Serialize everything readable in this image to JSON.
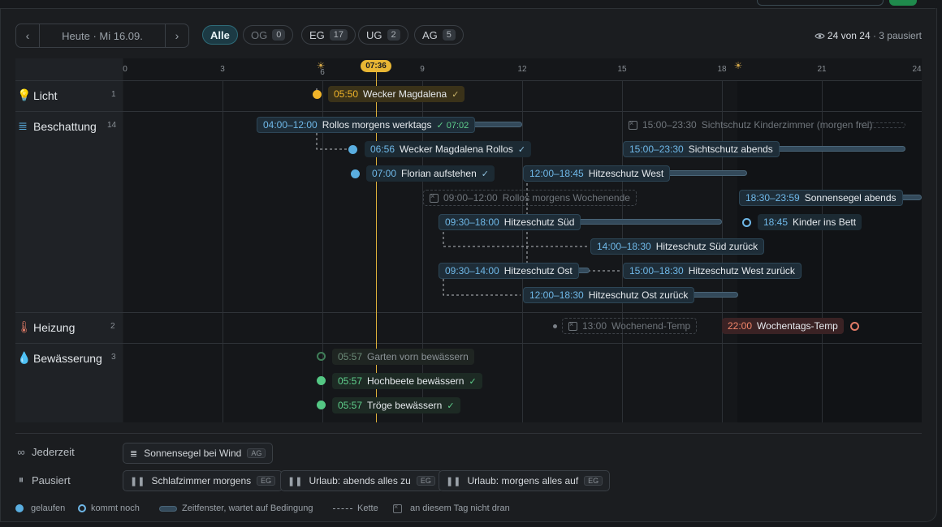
{
  "toolbar": {
    "prev": "‹",
    "next": "›",
    "date_label": "Heute · Mi 16.09.",
    "filters": [
      {
        "label": "Alle",
        "count": "",
        "active": true
      },
      {
        "label": "OG",
        "count": "0",
        "active": false
      },
      {
        "label": "EG",
        "count": "17",
        "active": false
      },
      {
        "label": "UG",
        "count": "2",
        "active": false
      },
      {
        "label": "AG",
        "count": "5",
        "active": false
      }
    ],
    "visible": "24 von 24",
    "paused": " · 3 pausiert"
  },
  "timeline": {
    "ticks": [
      "0",
      "3",
      "6",
      "9",
      "12",
      "15",
      "18",
      "21",
      "24"
    ],
    "now": "07:36",
    "categories": [
      {
        "name": "Licht",
        "count": "1"
      },
      {
        "name": "Beschattung",
        "count": "14"
      },
      {
        "name": "Heizung",
        "count": "2"
      },
      {
        "name": "Bewässerung",
        "count": "3"
      }
    ],
    "events": [
      {
        "id": "e1",
        "time": "05:50",
        "title": "Wecker Magdalena",
        "status": "✓"
      },
      {
        "id": "e2",
        "time": "04:00–12:00",
        "title": "Rollos morgens werktags",
        "status": "✓ 07:02"
      },
      {
        "id": "e3",
        "time": "06:56",
        "title": "Wecker Magdalena Rollos",
        "status": "✓"
      },
      {
        "id": "e4",
        "time": "07:00",
        "title": "Florian aufstehen",
        "status": "✓"
      },
      {
        "id": "e5",
        "time": "09:00–12:00",
        "title": "Rollos morgens Wochenende",
        "status": ""
      },
      {
        "id": "e6",
        "time": "09:30–18:00",
        "title": "Hitzeschutz Süd",
        "status": ""
      },
      {
        "id": "e7",
        "time": "09:30–14:00",
        "title": "Hitzeschutz Ost",
        "status": ""
      },
      {
        "id": "e8",
        "time": "12:00–18:45",
        "title": "Hitzeschutz West",
        "status": ""
      },
      {
        "id": "e9",
        "time": "12:00–18:30",
        "title": "Hitzeschutz Ost zurück",
        "status": ""
      },
      {
        "id": "e10",
        "time": "14:00–18:30",
        "title": "Hitzeschutz Süd zurück",
        "status": ""
      },
      {
        "id": "e11",
        "time": "15:00–23:30",
        "title": "Sichtschutz Kinderzimmer (morgen frei)",
        "status": ""
      },
      {
        "id": "e12",
        "time": "15:00–23:30",
        "title": "Sichtschutz abends",
        "status": ""
      },
      {
        "id": "e13",
        "time": "15:00–18:30",
        "title": "Hitzeschutz West zurück",
        "status": ""
      },
      {
        "id": "e14",
        "time": "18:30–23:59",
        "title": "Sonnensegel abends",
        "status": ""
      },
      {
        "id": "e15",
        "time": "18:45",
        "title": "Kinder ins Bett",
        "status": ""
      },
      {
        "id": "e16",
        "time": "13:00",
        "title": "Wochenend-Temp",
        "status": ""
      },
      {
        "id": "e17",
        "time": "22:00",
        "title": "Wochentags-Temp",
        "status": ""
      },
      {
        "id": "e18",
        "time": "05:57",
        "title": "Garten vorn bewässern",
        "status": ""
      },
      {
        "id": "e19",
        "time": "05:57",
        "title": "Hochbeete bewässern",
        "status": "✓"
      },
      {
        "id": "e20",
        "time": "05:57",
        "title": "Tröge bewässern",
        "status": "✓"
      }
    ]
  },
  "bottom": {
    "anytime_label": "Jederzeit",
    "anytime_items": [
      {
        "title": "Sonnensegel bei Wind",
        "tag": "AG"
      }
    ],
    "paused_label": "Pausiert",
    "paused_items": [
      {
        "title": "Schlafzimmer morgens",
        "tag": "EG"
      },
      {
        "title": "Urlaub: abends alles zu",
        "tag": "EG"
      },
      {
        "title": "Urlaub: morgens alles auf",
        "tag": "EG"
      }
    ],
    "legend": {
      "ran": "gelaufen",
      "upcoming": "kommt noch",
      "window": "Zeitfenster, wartet auf Bedingung",
      "chain": "Kette",
      "not_today": "an diesem Tag nicht dran"
    }
  },
  "colors": {
    "accent": "#2e6b78",
    "now": "#e8b634",
    "ran_blue": "#5aaee0",
    "licht": "#f0b429",
    "bewaesserung": "#54c784",
    "heizung": "#e07a66"
  },
  "icons": {
    "licht": "lightbulb-icon",
    "beschattung": "blinds-icon",
    "heizung": "thermometer-icon",
    "bewaesserung": "water-drop-icon",
    "anytime": "infinity-icon",
    "paused": "pause-icon",
    "visibility": "eye-icon",
    "sun": "sun-icon"
  }
}
